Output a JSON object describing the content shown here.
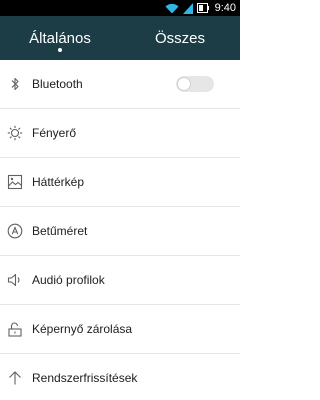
{
  "status_bar": {
    "time": "9:40",
    "icons": [
      "wifi-icon",
      "signal-icon",
      "battery-icon"
    ]
  },
  "tabs": [
    {
      "label": "Általános",
      "active": true
    },
    {
      "label": "Összes",
      "active": false
    }
  ],
  "settings": [
    {
      "label": "Bluetooth",
      "icon": "bluetooth-icon",
      "toggle": false
    },
    {
      "label": "Fényerő",
      "icon": "brightness-icon"
    },
    {
      "label": "Háttérkép",
      "icon": "wallpaper-icon"
    },
    {
      "label": "Betűméret",
      "icon": "font-size-icon"
    },
    {
      "label": "Audió profilok",
      "icon": "speaker-icon"
    },
    {
      "label": "Képernyő zárolása",
      "icon": "lock-icon"
    },
    {
      "label": "Rendszerfrissítések",
      "icon": "arrow-up-icon"
    }
  ],
  "colors": {
    "header": "#1c3d45",
    "statusbar": "#000000",
    "wifi": "#31b6e7",
    "text": "#202020",
    "divider": "#e6e6e6"
  }
}
